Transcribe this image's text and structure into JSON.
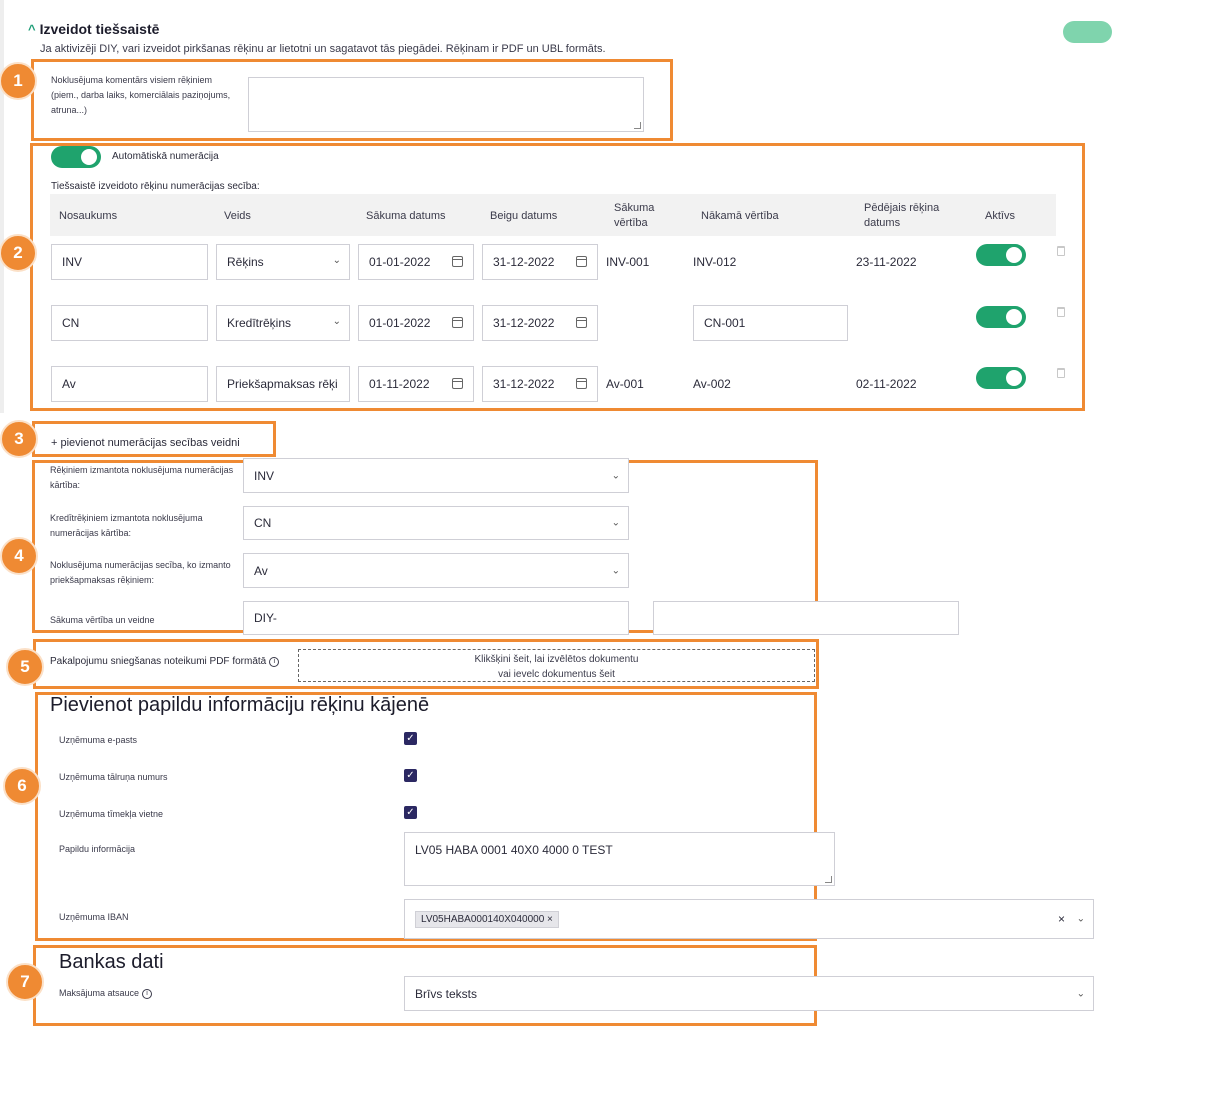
{
  "header": {
    "title": "Izveidot tiešsaistē",
    "description": "Ja aktivizēji DIY, vari izveidot pirkšanas rēķinu ar lietotni un sagatavot tās piegādei. Rēķinam ir PDF un UBL formāts."
  },
  "markers": [
    "1",
    "2",
    "3",
    "4",
    "5",
    "6",
    "7"
  ],
  "comment": {
    "label_lines": [
      "Noklusējuma komentārs visiem rēķiniem",
      "(piem., darba laiks, komerciālais paziņojums,",
      "atruna...)"
    ],
    "value": ""
  },
  "numbering": {
    "auto_label": "Automātiskā numerācija",
    "sequence_label": "Tiešsaistē izveidoto rēķinu numerācijas secība:",
    "columns": {
      "name": "Nosaukums",
      "type": "Veids",
      "start_date": "Sākuma datums",
      "end_date": "Beigu datums",
      "start_value_1": "Sākuma",
      "start_value_2": "vērtība",
      "next_value": "Nākamā vērtība",
      "last_date_1": "Pēdējais rēķina",
      "last_date_2": "datums",
      "active": "Aktīvs"
    },
    "rows": [
      {
        "name": "INV",
        "type": "Rēķins",
        "start_date": "01-01-2022",
        "end_date": "31-12-2022",
        "start_value": "INV-001",
        "next_value": "INV-012",
        "last_date": "23-11-2022",
        "active": true
      },
      {
        "name": "CN",
        "type": "Kredītrēķins",
        "start_date": "01-01-2022",
        "end_date": "31-12-2022",
        "start_value": "",
        "next_value": "CN-001",
        "last_date": "",
        "active": true
      },
      {
        "name": "Av",
        "type": "Priekšapmaksas rēķi",
        "start_date": "01-11-2022",
        "end_date": "31-12-2022",
        "start_value": "Av-001",
        "next_value": "Av-002",
        "last_date": "02-11-2022",
        "active": true
      }
    ]
  },
  "add_sequence": "+ pievienot numerācijas secības veidni",
  "defaults": {
    "invoice_label": [
      "Rēķiniem izmantota noklusējuma numerācijas",
      "kārtība:"
    ],
    "invoice_value": "INV",
    "credit_label": [
      "Kredītrēķiniem izmantota noklusējuma",
      "numerācijas kārtība:"
    ],
    "credit_value": "CN",
    "prepay_label": [
      "Noklusējuma numerācijas secība, ko izmanto",
      "priekšapmaksas rēķiniem:"
    ],
    "prepay_value": "Av",
    "start_label": "Sākuma vērtība un veidne",
    "start_value": "DIY-",
    "start_value_2": ""
  },
  "terms": {
    "label": "Pakalpojumu sniegšanas noteikumi PDF formātā",
    "drop_line1": "Klikšķini šeit, lai izvēlētos dokumentu",
    "drop_line2": "vai ievelc dokumentus šeit"
  },
  "footer_info": {
    "title": "Pievienot papildu informāciju rēķinu kājenē",
    "email_label": "Uzņēmuma e-pasts",
    "phone_label": "Uzņēmuma tālruņa numurs",
    "website_label": "Uzņēmuma tīmekļa vietne",
    "extra_label": "Papildu informācija",
    "extra_value": "LV05 HABA 0001 40X0 4000 0 TEST",
    "iban_label": "Uzņēmuma IBAN",
    "iban_chip": "LV05HABA000140X040000",
    "chip_remove": "×",
    "clear": "×"
  },
  "bank": {
    "title": "Bankas dati",
    "reference_label": "Maksājuma atsauce",
    "reference_value": "Brīvs teksts"
  },
  "colors": {
    "accent": "#1fa36d",
    "highlight": "#ef8a33",
    "checkbox": "#2b2862"
  }
}
